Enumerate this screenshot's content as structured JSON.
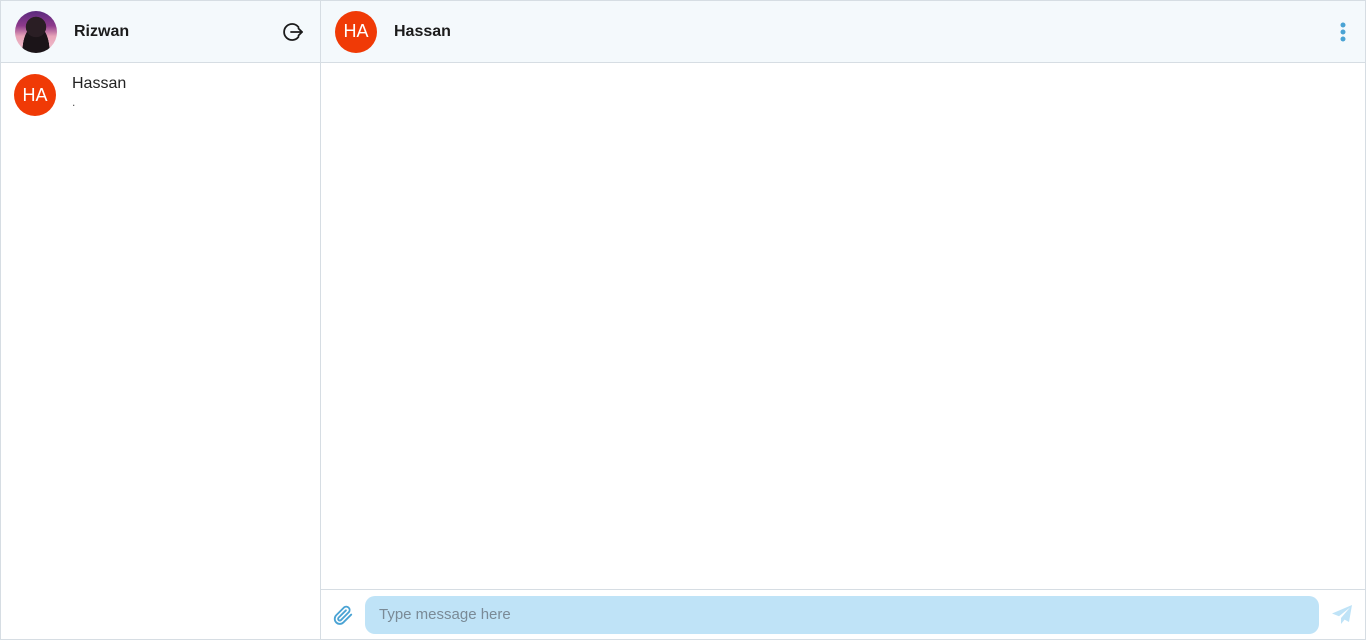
{
  "current_user": {
    "name": "Rizwan",
    "avatar": "profile-photo"
  },
  "sidebar": {
    "logout_icon": "logout-icon",
    "chats": [
      {
        "initials": "HA",
        "name": "Hassan",
        "preview": "."
      }
    ]
  },
  "conversation": {
    "contact_initials": "HA",
    "contact_name": "Hassan",
    "menu_icon": "kebab-menu-icon"
  },
  "composer": {
    "placeholder": "Type message here",
    "value": "",
    "attach_icon": "paperclip-icon",
    "send_icon": "send-icon"
  },
  "colors": {
    "header_bg": "#f4f9fc",
    "avatar_bg": "#f03a06",
    "input_bg": "#bfe3f7",
    "accent": "#4aa3d4"
  }
}
